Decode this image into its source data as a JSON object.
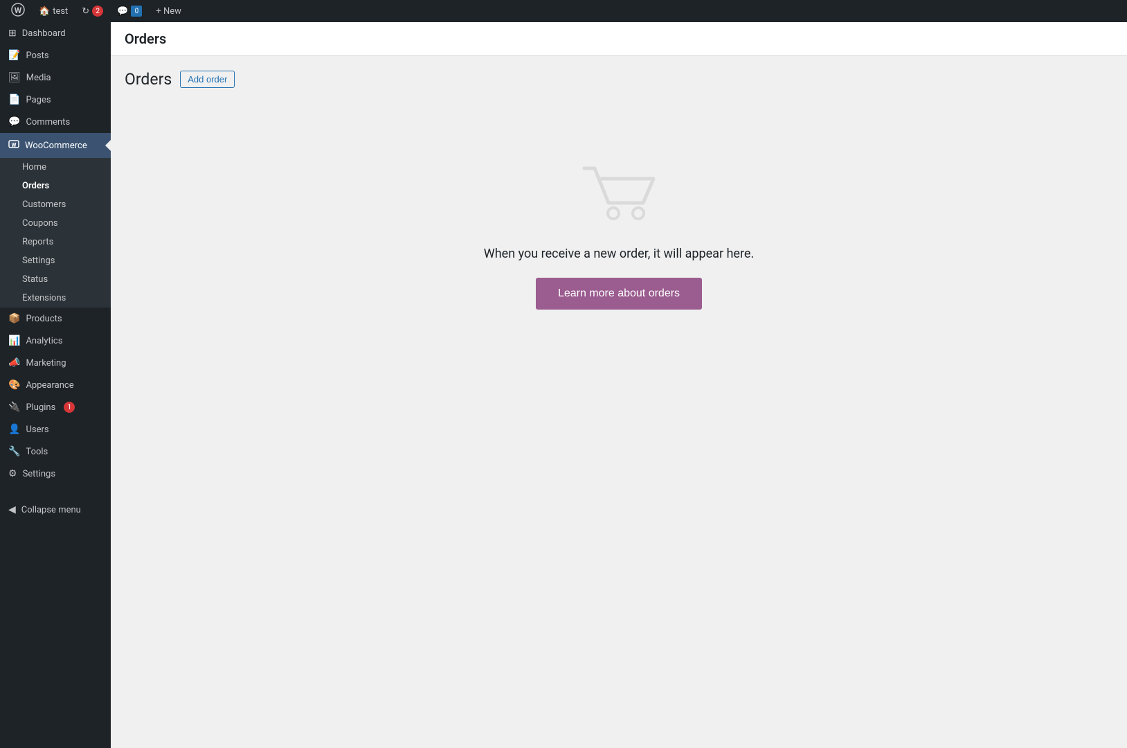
{
  "adminbar": {
    "wp_icon": "⊞",
    "site_name": "test",
    "updates_count": "2",
    "comments_count": "0",
    "new_label": "+ New"
  },
  "page_header": {
    "title": "Orders"
  },
  "orders_page": {
    "heading": "Orders",
    "add_order_label": "Add order",
    "empty_state_text": "When you receive a new order, it will appear here.",
    "learn_more_label": "Learn more about orders"
  },
  "sidebar": {
    "dashboard_label": "Dashboard",
    "posts_label": "Posts",
    "media_label": "Media",
    "pages_label": "Pages",
    "comments_label": "Comments",
    "woocommerce_label": "WooCommerce",
    "submenu": {
      "home_label": "Home",
      "orders_label": "Orders",
      "customers_label": "Customers",
      "coupons_label": "Coupons",
      "reports_label": "Reports",
      "settings_label": "Settings",
      "status_label": "Status",
      "extensions_label": "Extensions"
    },
    "products_label": "Products",
    "analytics_label": "Analytics",
    "marketing_label": "Marketing",
    "appearance_label": "Appearance",
    "plugins_label": "Plugins",
    "plugins_badge": "1",
    "users_label": "Users",
    "tools_label": "Tools",
    "settings_label": "Settings",
    "collapse_label": "Collapse menu"
  }
}
